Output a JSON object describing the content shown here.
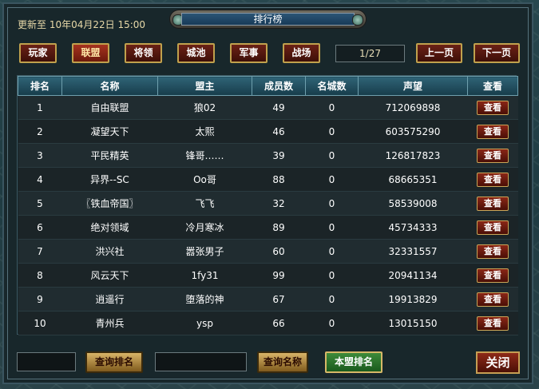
{
  "header": {
    "update_text": "更新至 10年04月22日 15:00",
    "title": "排行榜"
  },
  "tabs": [
    {
      "label": "玩家",
      "active": false
    },
    {
      "label": "联盟",
      "active": true
    },
    {
      "label": "将领",
      "active": false
    },
    {
      "label": "城池",
      "active": false
    },
    {
      "label": "军事",
      "active": false
    },
    {
      "label": "战场",
      "active": false
    }
  ],
  "pagination": {
    "page_text": "1/27",
    "prev_label": "上一页",
    "next_label": "下一页"
  },
  "table": {
    "columns": [
      "排名",
      "名称",
      "盟主",
      "成员数",
      "名城数",
      "声望",
      "查看"
    ],
    "view_label": "查看",
    "rows": [
      {
        "rank": "1",
        "name": "自由联盟",
        "leader": "狼02",
        "members": "49",
        "cities": "0",
        "prestige": "712069898"
      },
      {
        "rank": "2",
        "name": "凝望天下",
        "leader": "太熙",
        "members": "46",
        "cities": "0",
        "prestige": "603575290"
      },
      {
        "rank": "3",
        "name": "平民精英",
        "leader": "锋哥……",
        "members": "39",
        "cities": "0",
        "prestige": "126817823"
      },
      {
        "rank": "4",
        "name": "异界--SC",
        "leader": "Oo哥",
        "members": "88",
        "cities": "0",
        "prestige": "68665351"
      },
      {
        "rank": "5",
        "name": "〖铁血帝国〗",
        "leader": "飞飞",
        "members": "32",
        "cities": "0",
        "prestige": "58539008"
      },
      {
        "rank": "6",
        "name": "绝对领域",
        "leader": "冷月寒冰",
        "members": "89",
        "cities": "0",
        "prestige": "45734333"
      },
      {
        "rank": "7",
        "name": "洪兴社",
        "leader": "嚣张男子",
        "members": "60",
        "cities": "0",
        "prestige": "32331557"
      },
      {
        "rank": "8",
        "name": "风云天下",
        "leader": "1fy31",
        "members": "99",
        "cities": "0",
        "prestige": "20941134"
      },
      {
        "rank": "9",
        "name": "逍遥行",
        "leader": "堕落的神",
        "members": "67",
        "cities": "0",
        "prestige": "19913829"
      },
      {
        "rank": "10",
        "name": "青州兵",
        "leader": "ysp",
        "members": "66",
        "cities": "0",
        "prestige": "13015150"
      }
    ]
  },
  "footer": {
    "rank_input_value": "",
    "query_rank_label": "查询排名",
    "name_input_value": "",
    "query_name_label": "查询名称",
    "my_alliance_rank_label": "本盟排名",
    "close_label": "关闭"
  }
}
